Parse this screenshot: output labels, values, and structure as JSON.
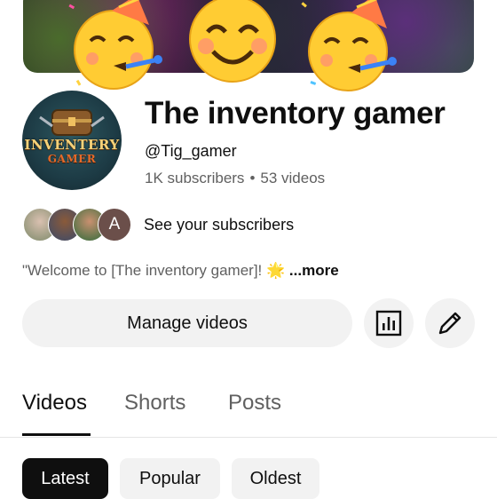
{
  "banner": {
    "stickers": [
      "partying-face-icon",
      "smiling-face-icon",
      "partying-face-icon"
    ]
  },
  "channel": {
    "title": "The inventory gamer",
    "handle": "@Tig_gamer",
    "subscribers": "1K subscribers",
    "videos": "53 videos",
    "avatar_text_1": "INVENTERY",
    "avatar_text_2": "GAMER"
  },
  "subscribers_row": {
    "label": "See your subscribers",
    "initial": "A"
  },
  "description": {
    "text": "\"Welcome to [The inventory gamer]! 🌟",
    "more": "...more"
  },
  "actions": {
    "manage_label": "Manage videos",
    "analytics_icon": "analytics-icon",
    "edit_icon": "pencil-icon"
  },
  "tabs": [
    {
      "label": "Videos",
      "active": true
    },
    {
      "label": "Shorts",
      "active": false
    },
    {
      "label": "Posts",
      "active": false
    }
  ],
  "chips": [
    {
      "label": "Latest",
      "active": true
    },
    {
      "label": "Popular",
      "active": false
    },
    {
      "label": "Oldest",
      "active": false
    }
  ],
  "colors": {
    "text_primary": "#0f0f0f",
    "text_secondary": "#606060",
    "button_bg": "#f2f2f2",
    "chip_active_bg": "#0f0f0f"
  }
}
